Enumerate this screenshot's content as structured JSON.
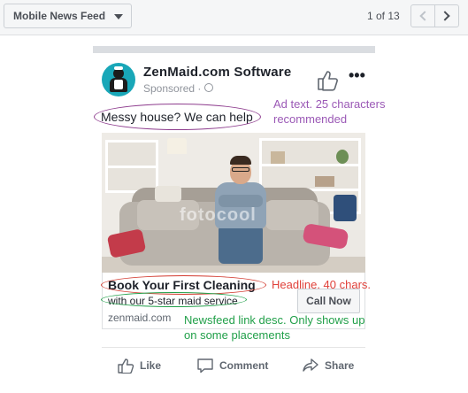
{
  "toolbar": {
    "placement_label": "Mobile News Feed",
    "pager_text": "1 of 13"
  },
  "post": {
    "page_name": "ZenMaid.com Software",
    "sponsored_label": "Sponsored",
    "ad_text": "Messy house? We can help",
    "image_watermark": "fotocool",
    "headline": "Book Your First Cleaning",
    "link_description": "with our 5-star maid service",
    "domain": "zenmaid.com",
    "cta_label": "Call Now",
    "actions": {
      "like": "Like",
      "comment": "Comment",
      "share": "Share"
    }
  },
  "annotations": {
    "ad_text_note": "Ad text. 25 characters recommended",
    "headline_note": "Headline. 40 chars.",
    "description_note": "Newsfeed link desc. Only shows up on some placements"
  },
  "colors": {
    "ad_text_annotation": "#9b59b6",
    "headline_annotation": "#e0413a",
    "description_annotation": "#22a04a",
    "avatar_bg": "#19a7b8"
  },
  "icons": [
    "chevron-down-icon",
    "chevron-left-icon",
    "chevron-right-icon",
    "globe-icon",
    "thumbs-up-icon",
    "more-icon",
    "comment-icon",
    "share-icon"
  ]
}
